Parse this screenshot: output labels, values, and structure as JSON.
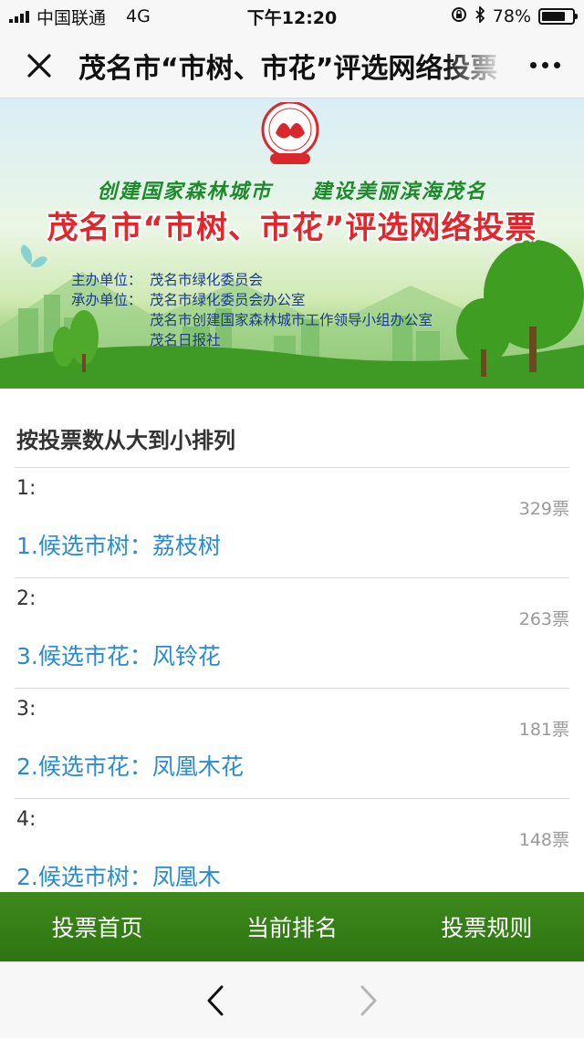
{
  "status_bar": {
    "carrier": "中国联通",
    "network": "4G",
    "time": "下午12:20",
    "battery": "78%",
    "battery_level": 0.78
  },
  "nav": {
    "title": "茂名市“市树、市花”评选网络投票",
    "close_icon": "close-icon",
    "more_icon": "more-icon"
  },
  "banner": {
    "slogan_left": "创建国家森林城市",
    "slogan_right": "建设美丽滨海茂名",
    "title": "茂名市“市树、市花”评选网络投票",
    "organizer_label": "主办单位：",
    "organizer": "茂名市绿化委员会",
    "undertaker_label": "承办单位：",
    "undertakers": [
      "茂名市绿化委员会办公室",
      "茂名市创建国家森林城市工作领导小组办公室",
      "茂名日报社"
    ]
  },
  "ranking": {
    "title": "按投票数从大到小排列",
    "items": [
      {
        "rank": "1:",
        "votes": "329票",
        "name": "1.候选市树：荔枝树"
      },
      {
        "rank": "2:",
        "votes": "263票",
        "name": "3.候选市花：风铃花"
      },
      {
        "rank": "3:",
        "votes": "181票",
        "name": "2.候选市花：凤凰木花"
      },
      {
        "rank": "4:",
        "votes": "148票",
        "name": "2.候选市树：凤凰木"
      }
    ]
  },
  "tabs": [
    "投票首页",
    "当前排名",
    "投票规则"
  ],
  "toolbar": {
    "back_icon": "chevron-left-icon",
    "forward_icon": "chevron-right-icon"
  },
  "colors": {
    "accent_green": "#2d7412",
    "link_blue": "#2a8bd0",
    "title_red": "#e3262b"
  }
}
